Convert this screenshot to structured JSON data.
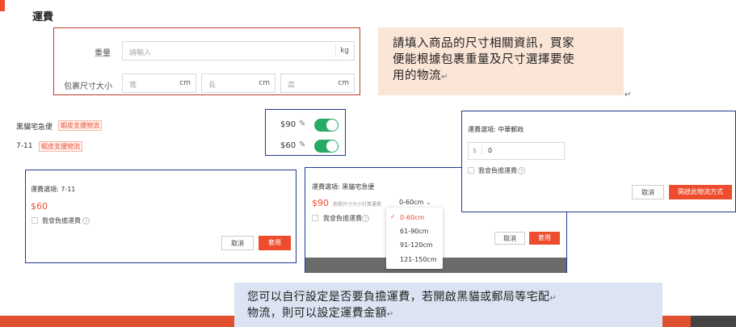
{
  "section": {
    "title": "運費"
  },
  "dimensions": {
    "weight_label": "重量",
    "weight_placeholder": "請輸入",
    "weight_unit": "kg",
    "size_label": "包裹尺寸大小",
    "length_placeholder": "寬",
    "width_placeholder": "長",
    "height_placeholder": "高",
    "size_unit": "cm"
  },
  "note_top": {
    "line1": "請填入商品的尺寸相關資訊，買家",
    "line2": "便能根據包裹重量及尺寸選擇要使",
    "line3": "用的物流",
    "return_mark": "↵",
    "stray_mark": "↵"
  },
  "carriers": [
    {
      "name": "黑貓宅急便",
      "tag": "蝦皮支援物流",
      "price": "$90"
    },
    {
      "name": "7-11",
      "tag": "蝦皮支援物流",
      "price": "$60"
    }
  ],
  "dialog_711": {
    "title": "運費選項: 7-11",
    "price": "$60",
    "checkbox_label": "我會負擔運費",
    "cancel": "取消",
    "apply": "套用"
  },
  "dialog_cat": {
    "title": "運費選項: 黑貓宅急便",
    "price": "$90",
    "hint": "依照尺寸大小計算運費",
    "selected_size": "0-60cm",
    "checkbox_label": "我會負擔運費",
    "cancel": "取消",
    "apply": "套用",
    "options": [
      "0-60cm",
      "61-90cm",
      "91-120cm",
      "121-150cm"
    ]
  },
  "dialog_post": {
    "title": "運費選項: 中華郵政",
    "currency": "$",
    "value": "0",
    "checkbox_label": "我會負擔運費",
    "cancel": "取消",
    "enable": "開啟此物流方式"
  },
  "note_bottom": {
    "line1": "您可以自行設定是否要負擔運費，若開啟黑貓或郵局等宅配",
    "line2": "物流，則可以設定運費金額",
    "return_mark": "↵"
  },
  "colors": {
    "accent": "#ee4d2d",
    "toggle_on": "#26aa66",
    "box_border": "#1f3a93",
    "note_peach": "#fbe5d6",
    "note_blue": "#dce3f2"
  }
}
